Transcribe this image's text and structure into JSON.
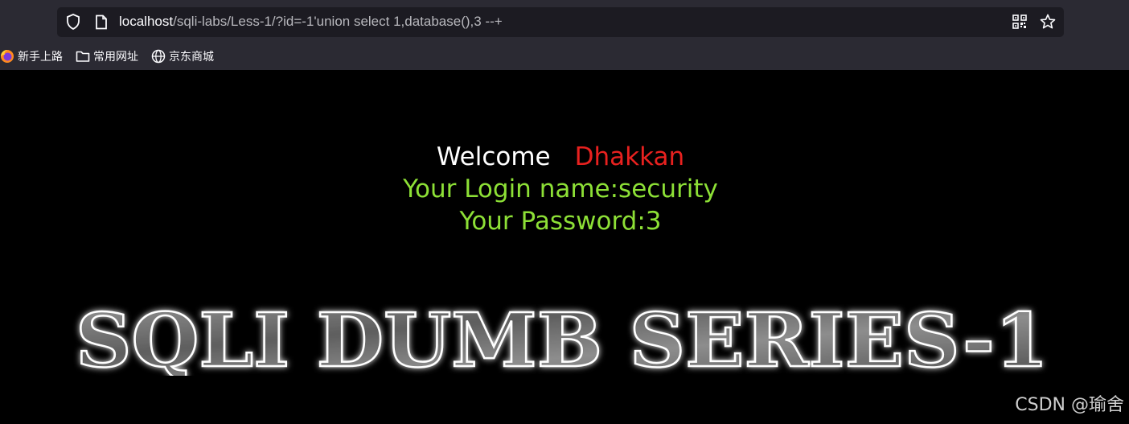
{
  "browser": {
    "url_host": "localhost",
    "url_path": "/sqli-labs/Less-1/?id=-1'union select 1,database(),3 --+",
    "icons": {
      "shield": "shield-icon",
      "page": "page-icon",
      "qr": "qr-code-icon",
      "bookmark_star": "star-icon"
    }
  },
  "bookmarks": [
    {
      "label": "新手上路",
      "icon": "firefox-icon"
    },
    {
      "label": "常用网址",
      "icon": "folder-icon"
    },
    {
      "label": "京东商城",
      "icon": "globe-icon"
    }
  ],
  "page": {
    "welcome_label": "Welcome",
    "welcome_name": "Dhakkan",
    "login_line": "Your Login name:security",
    "password_line": "Your Password:3",
    "banner_text": "SQLI DUMB SERIES-1"
  },
  "watermark": "CSDN @瑜舍",
  "colors": {
    "welcome": "#ffffff",
    "name": "#e8211f",
    "info": "#8de036"
  }
}
